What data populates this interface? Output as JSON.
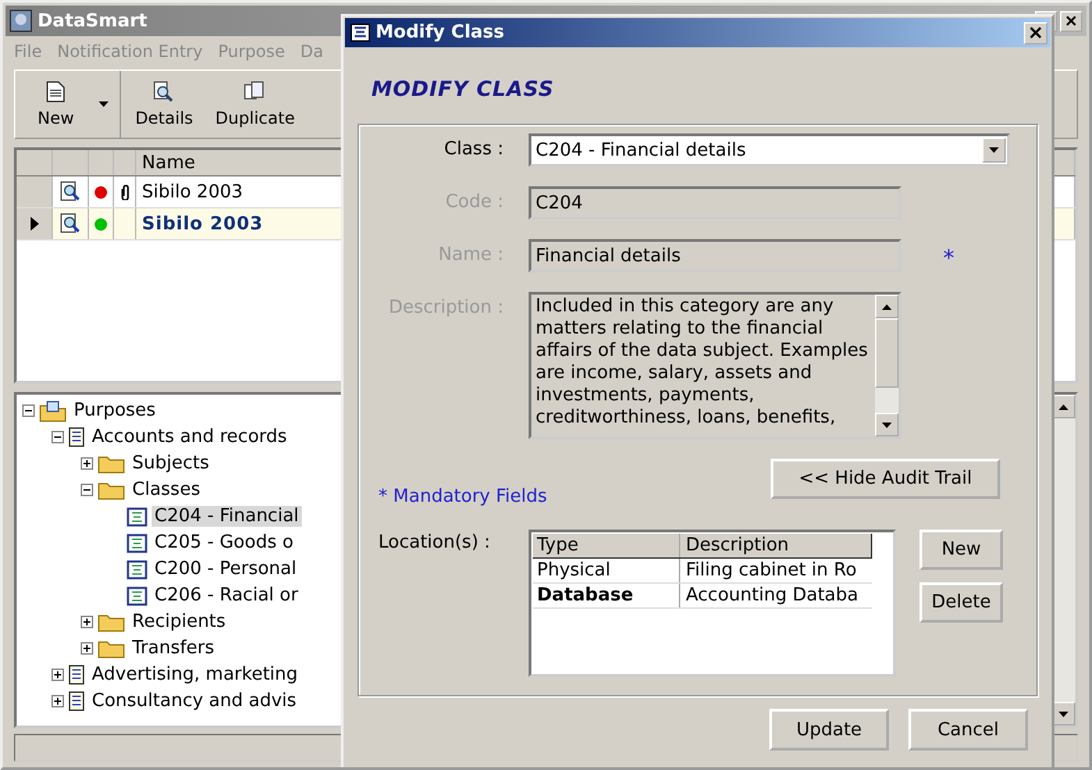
{
  "app": {
    "title": "DataSmart"
  },
  "menu": [
    "File",
    "Notification Entry",
    "Purpose",
    "Da"
  ],
  "toolbar": [
    {
      "label": "New",
      "kind": "new"
    },
    {
      "label": "Details",
      "kind": "details"
    },
    {
      "label": "Duplicate",
      "kind": "duplicate"
    }
  ],
  "grid": {
    "columns": [
      "Name"
    ],
    "rows": [
      {
        "color": "#e00000",
        "attachment": true,
        "name": "Sibilo 2003",
        "selected": false
      },
      {
        "color": "#00c000",
        "attachment": false,
        "name": "Sibilo 2003",
        "selected": true
      }
    ]
  },
  "tree": [
    {
      "label": "Purposes",
      "kind": "root",
      "expanded": true,
      "selected": false,
      "children": [
        {
          "label": "Accounts and records",
          "kind": "document",
          "expanded": true,
          "selected": false,
          "children": [
            {
              "label": "Subjects",
              "kind": "folder",
              "expanded": false,
              "selected": false
            },
            {
              "label": "Classes",
              "kind": "folder",
              "expanded": true,
              "selected": false,
              "children": [
                {
                  "label": "C204 - Financial",
                  "kind": "class",
                  "selected": true
                },
                {
                  "label": "C205 - Goods o",
                  "kind": "class",
                  "selected": false
                },
                {
                  "label": "C200 - Personal",
                  "kind": "class",
                  "selected": false
                },
                {
                  "label": "C206 - Racial or",
                  "kind": "class",
                  "selected": false
                }
              ]
            },
            {
              "label": "Recipients",
              "kind": "folder",
              "expanded": false,
              "selected": false
            },
            {
              "label": "Transfers",
              "kind": "folder",
              "expanded": false,
              "selected": false
            }
          ]
        },
        {
          "label": "Advertising, marketing",
          "kind": "document",
          "expanded": false,
          "selected": false
        },
        {
          "label": "Consultancy and advis",
          "kind": "document",
          "expanded": false,
          "selected": false
        }
      ]
    }
  ],
  "dialog": {
    "title": "Modify Class",
    "heading": "MODIFY CLASS",
    "fields": [
      {
        "label": "Class :",
        "kind": "select",
        "value": "C204 - Financial details",
        "disabled": false
      },
      {
        "label": "Code :",
        "kind": "text",
        "value": "C204",
        "disabled": true
      },
      {
        "label": "Name :",
        "kind": "text",
        "value": "Financial details",
        "disabled": true,
        "mark": "*"
      },
      {
        "label": "Description :",
        "kind": "memo",
        "value": "Included in this category are any matters relating to the financial affairs of the data subject. Examples are income, salary, assets and investments, payments, creditworthiness, loans, benefits,",
        "disabled": true
      }
    ],
    "mandatory_note": {
      "mark": "*",
      "text": "Mandatory Fields"
    },
    "audit_button": "<< Hide Audit Trail",
    "locations": {
      "label": "Location(s) :",
      "columns": [
        "Type",
        "Description"
      ],
      "rows": [
        {
          "type": "Physical",
          "description": "Filing cabinet in Ro",
          "selected": false
        },
        {
          "type": "Database",
          "description": "Accounting Databa",
          "selected": true
        }
      ],
      "buttons": [
        "New",
        "Delete"
      ]
    },
    "buttons": [
      "Update",
      "Cancel"
    ]
  }
}
